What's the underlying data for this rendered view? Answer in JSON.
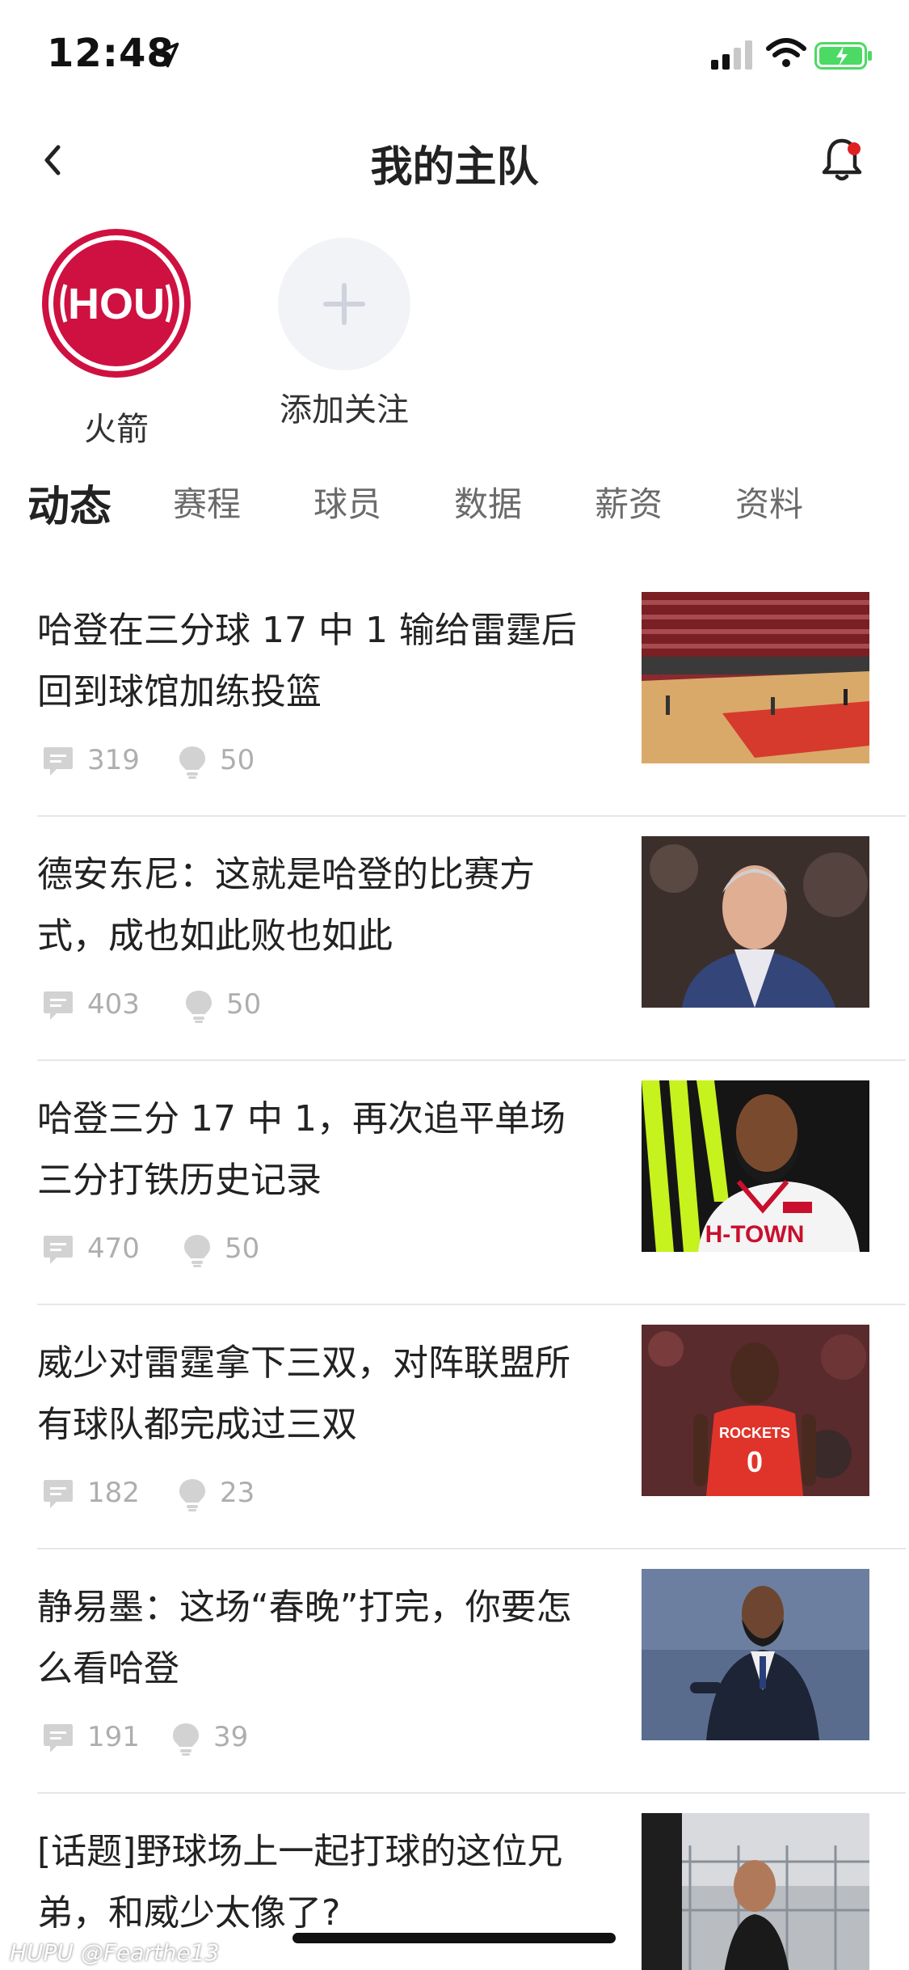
{
  "status": {
    "time": "12:48"
  },
  "nav": {
    "title": "我的主队"
  },
  "teams": [
    {
      "name": "火箭",
      "logo_text": "HOU"
    },
    {
      "name": "添加关注"
    }
  ],
  "tabs": [
    "动态",
    "赛程",
    "球员",
    "数据",
    "薪资",
    "资料"
  ],
  "news": [
    {
      "title": "哈登在三分球 17 中 1 输给雷霆后回到球馆加练投篮",
      "comments": "319",
      "likes": "50"
    },
    {
      "title": "德安东尼：这就是哈登的比赛方式，成也如此败也如此",
      "comments": "403",
      "likes": "50"
    },
    {
      "title": "哈登三分 17 中 1，再次追平单场三分打铁历史记录",
      "comments": "470",
      "likes": "50"
    },
    {
      "title": "威少对雷霆拿下三双，对阵联盟所有球队都完成过三双",
      "comments": "182",
      "likes": "23"
    },
    {
      "title": "静易墨：这场“春晚”打完，你要怎么看哈登",
      "comments": "191",
      "likes": "39"
    },
    {
      "title": "[话题]野球场上一起打球的这位兄弟，和威少太像了?",
      "comments": "",
      "likes": ""
    }
  ],
  "thumb_text": {
    "jersey1": "H-TOWN",
    "jersey2": "ROCKETS",
    "jersey2_number": "0"
  },
  "watermark": "HUPU @Fearthe13",
  "colors": {
    "rockets_red": "#ce1141",
    "bell_dot": "#e02020",
    "meta_gray": "#aeaeae",
    "battery_green": "#4cd964"
  }
}
